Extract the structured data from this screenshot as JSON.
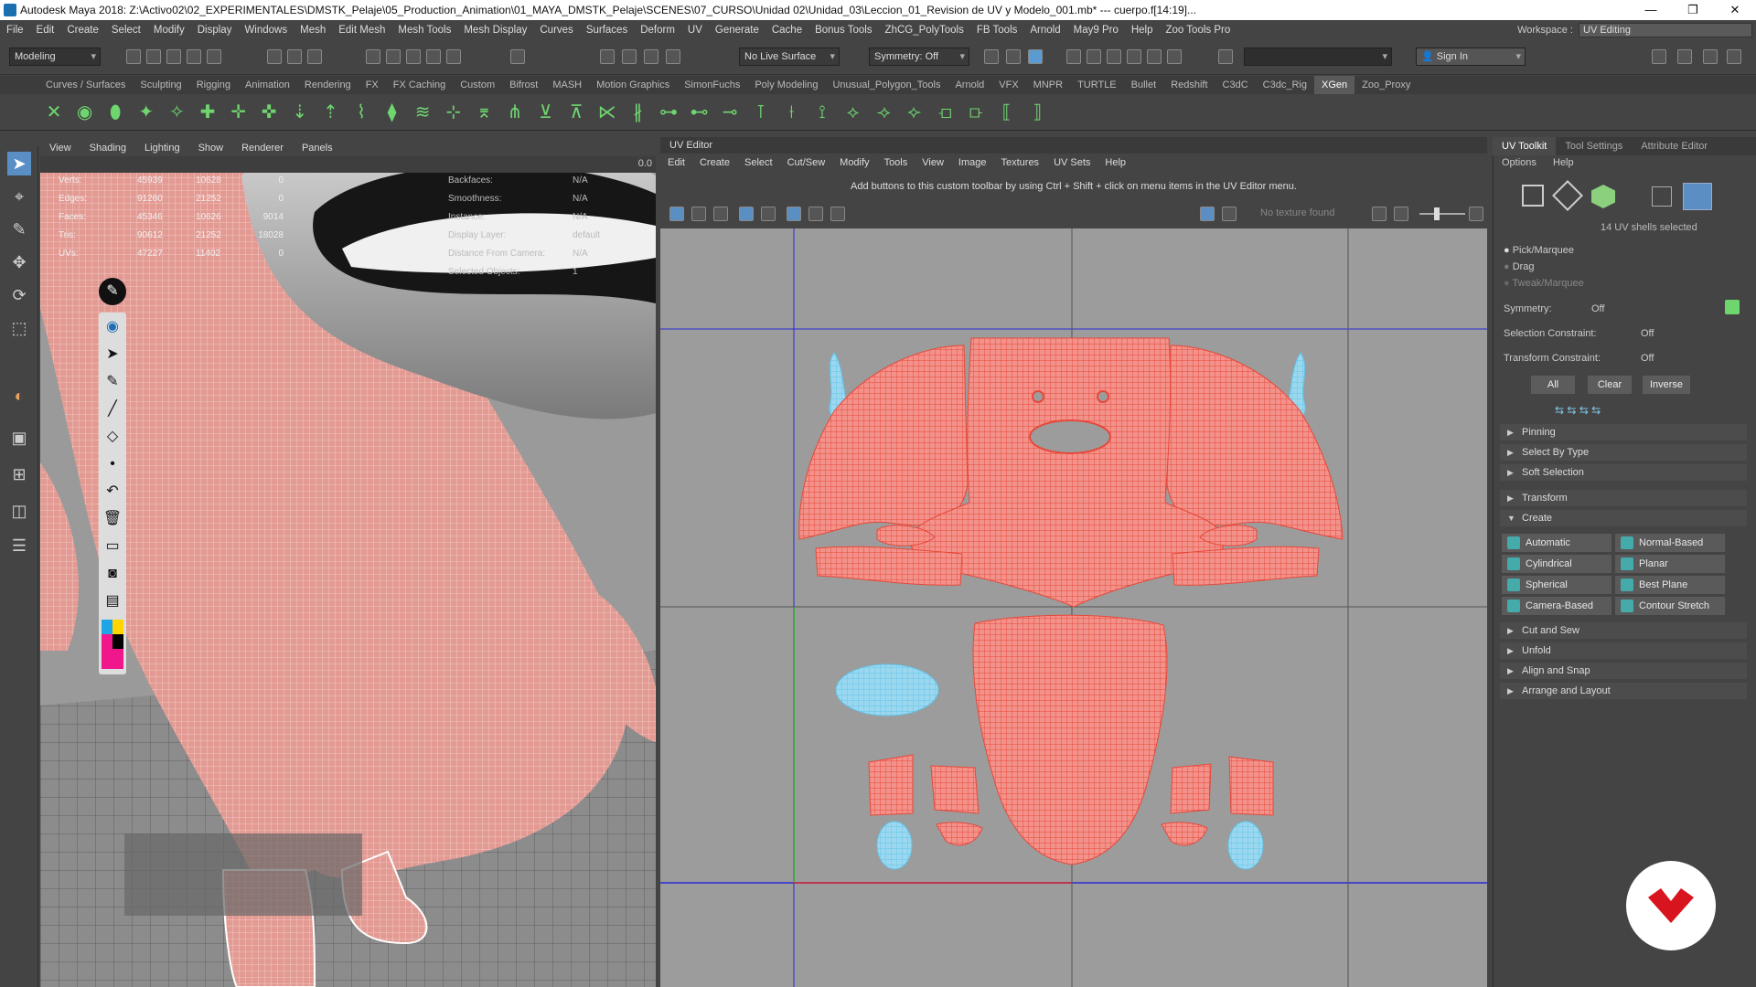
{
  "window": {
    "title": "Autodesk Maya 2018: Z:\\Activo02\\02_EXPERIMENTALES\\DMSTK_Pelaje\\05_Production_Animation\\01_MAYA_DMSTK_Pelaje\\SCENES\\07_CURSO\\Unidad 02\\Unidad_03\\Leccion_01_Revision de UV y Modelo_001.mb*  ---  cuerpo.f[14:19]...",
    "minimize": "—",
    "restore": "❐",
    "close": "✕"
  },
  "menubar": [
    "File",
    "Edit",
    "Create",
    "Select",
    "Modify",
    "Display",
    "Windows",
    "Mesh",
    "Edit Mesh",
    "Mesh Tools",
    "Mesh Display",
    "Curves",
    "Surfaces",
    "Deform",
    "UV",
    "Generate",
    "Cache",
    "Bonus Tools",
    "ZhCG_PolyTools",
    "FB Tools",
    "Arnold",
    "May9 Pro",
    "Help",
    "Zoo Tools Pro"
  ],
  "workspace": {
    "label": "Workspace :",
    "value": "UV Editing"
  },
  "status": {
    "mode": "Modeling",
    "live_surface": "No Live Surface",
    "symmetry": "Symmetry: Off",
    "sign_in": "Sign In"
  },
  "shelf_tabs": [
    "Curves / Surfaces",
    "Sculpting",
    "Rigging",
    "Animation",
    "Rendering",
    "FX",
    "FX Caching",
    "Custom",
    "Bifrost",
    "MASH",
    "Motion Graphics",
    "SimonFuchs",
    "Poly Modeling",
    "Unusual_Polygon_Tools",
    "Arnold",
    "VFX",
    "MNPR",
    "TURTLE",
    "Bullet",
    "Redshift",
    "C3dC",
    "C3dc_Rig",
    "XGen",
    "Zoo_Proxy"
  ],
  "shelf_active": "XGen",
  "viewport": {
    "menu": [
      "View",
      "Shading",
      "Lighting",
      "Show",
      "Renderer",
      "Panels"
    ],
    "hud_labels": [
      "Verts:",
      "Edges:",
      "Faces:",
      "Tris:",
      "UVs:"
    ],
    "hud_col1": [
      "45939",
      "91260",
      "45346",
      "90612",
      "47227"
    ],
    "hud_col2": [
      "10628",
      "21252",
      "10626",
      "21252",
      "11402"
    ],
    "hud_col3": [
      "0",
      "0",
      "9014",
      "18028",
      "0"
    ],
    "hud_right_labels": [
      "Backfaces:",
      "Smoothness:",
      "Instance:",
      "Display Layer:",
      "Distance From Camera:",
      "Selected Objects:"
    ],
    "hud_right_values": [
      "N/A",
      "N/A",
      "N/A",
      "default",
      "N/A",
      "1"
    ],
    "field_value": "0.0"
  },
  "uv_editor": {
    "title": "UV Editor",
    "menu": [
      "Edit",
      "Create",
      "Select",
      "Cut/Sew",
      "Modify",
      "Tools",
      "View",
      "Image",
      "Textures",
      "UV Sets",
      "Help"
    ],
    "hint": "Add buttons to this custom toolbar by using Ctrl + Shift + click on menu items in the UV Editor menu.",
    "no_texture": "No texture found"
  },
  "uv_toolkit": {
    "tabs": [
      "UV Toolkit",
      "Tool Settings",
      "Attribute Editor"
    ],
    "menu": [
      "Options",
      "Help"
    ],
    "shells_selected": "14 UV shells selected",
    "modes": [
      "Pick/Marquee",
      "Drag",
      "Tweak/Marquee"
    ],
    "symmetry_label": "Symmetry:",
    "symmetry_value": "Off",
    "sel_constraint_label": "Selection Constraint:",
    "sel_constraint_value": "Off",
    "trans_constraint_label": "Transform Constraint:",
    "trans_constraint_value": "Off",
    "buttons": [
      "All",
      "Clear",
      "Inverse"
    ],
    "sections_top": [
      "Pinning",
      "Select By Type",
      "Soft Selection"
    ],
    "transform": "Transform",
    "create": "Create",
    "create_buttons": [
      "Automatic",
      "Normal-Based",
      "Cylindrical",
      "Planar",
      "Spherical",
      "Best Plane",
      "Camera-Based",
      "Contour Stretch"
    ],
    "sections_bottom": [
      "Cut and Sew",
      "Unfold",
      "Align and Snap",
      "Arrange and Layout"
    ]
  },
  "colors": {
    "uv_selected": "#e8483a",
    "uv_unselected": "#62c3e8",
    "viewport_bg": "#9a9a9a",
    "body": "#e79b95"
  }
}
